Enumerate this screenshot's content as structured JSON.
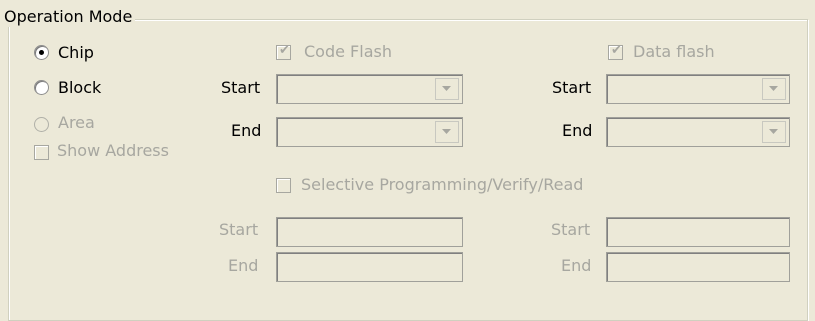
{
  "group": {
    "title": "Operation Mode"
  },
  "mode_radios": [
    {
      "label": "Chip",
      "selected": true,
      "enabled": true
    },
    {
      "label": "Block",
      "selected": false,
      "enabled": true
    },
    {
      "label": "Area",
      "selected": false,
      "enabled": false
    }
  ],
  "show_address": {
    "label": "Show Address",
    "checked": false
  },
  "code_flash": {
    "label": "Code Flash",
    "checked": true,
    "start_label": "Start",
    "end_label": "End",
    "start_value": "",
    "end_value": ""
  },
  "data_flash": {
    "label": "Data flash",
    "checked": true,
    "start_label": "Start",
    "end_label": "End",
    "start_value": "",
    "end_value": ""
  },
  "selective": {
    "label": "Selective Programming/Verify/Read",
    "checked": false,
    "left": {
      "start_label": "Start",
      "end_label": "End",
      "start_value": "",
      "end_value": ""
    },
    "right": {
      "start_label": "Start",
      "end_label": "End",
      "start_value": "",
      "end_value": ""
    }
  },
  "icons": {
    "dropdown": "chevron-down-icon",
    "check": "checkmark-icon",
    "radio_dot": "radio-dot-icon"
  }
}
